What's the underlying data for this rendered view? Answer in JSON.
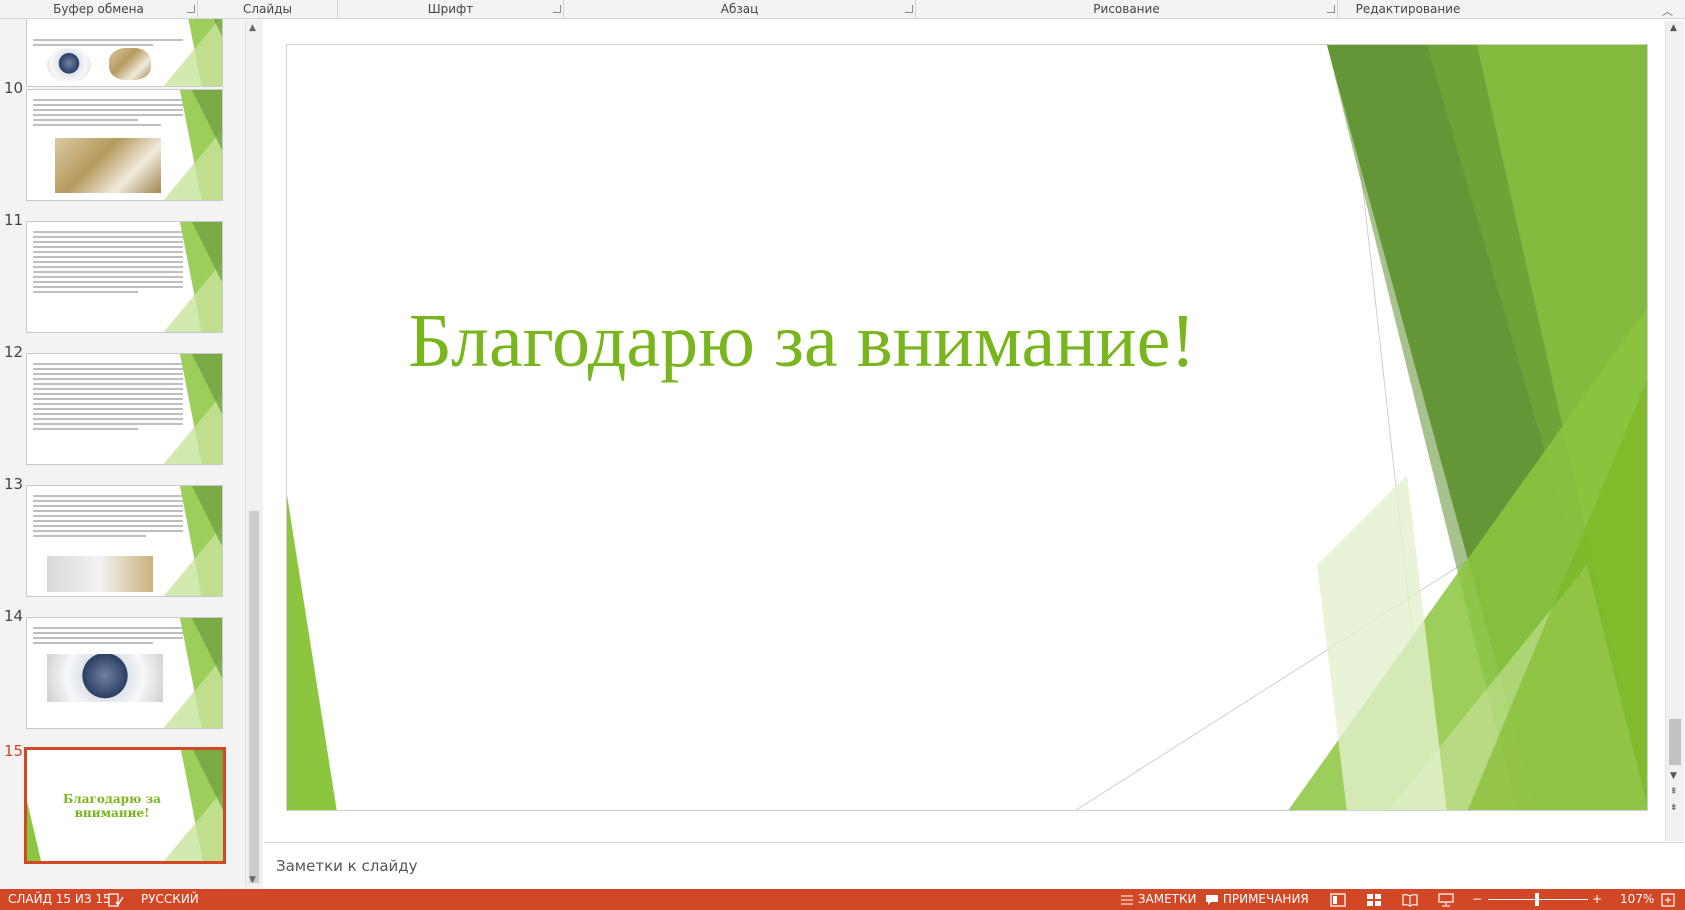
{
  "ribbon": {
    "groups": [
      "Буфер обмена",
      "Слайды",
      "Шрифт",
      "Абзац",
      "Рисование",
      "Редактирование"
    ]
  },
  "thumbnails": [
    {
      "number": "10"
    },
    {
      "number": "11"
    },
    {
      "number": "12"
    },
    {
      "number": "13"
    },
    {
      "number": "14"
    },
    {
      "number": "15",
      "title": "Благодарю за внимание!"
    }
  ],
  "slide": {
    "title": "Благодарю за внимание!"
  },
  "notes": {
    "placeholder": "Заметки к слайду"
  },
  "status": {
    "slide_info": "СЛАЙД 15 ИЗ 15",
    "language": "РУССКИЙ",
    "notes_label": "ЗАМЕТКИ",
    "comments_label": "ПРИМЕЧАНИЯ",
    "zoom": "107%",
    "zoom_minus": "−",
    "zoom_plus": "+"
  },
  "colors": {
    "accent_green": "#7ab51d",
    "status_bar": "#d24726"
  }
}
